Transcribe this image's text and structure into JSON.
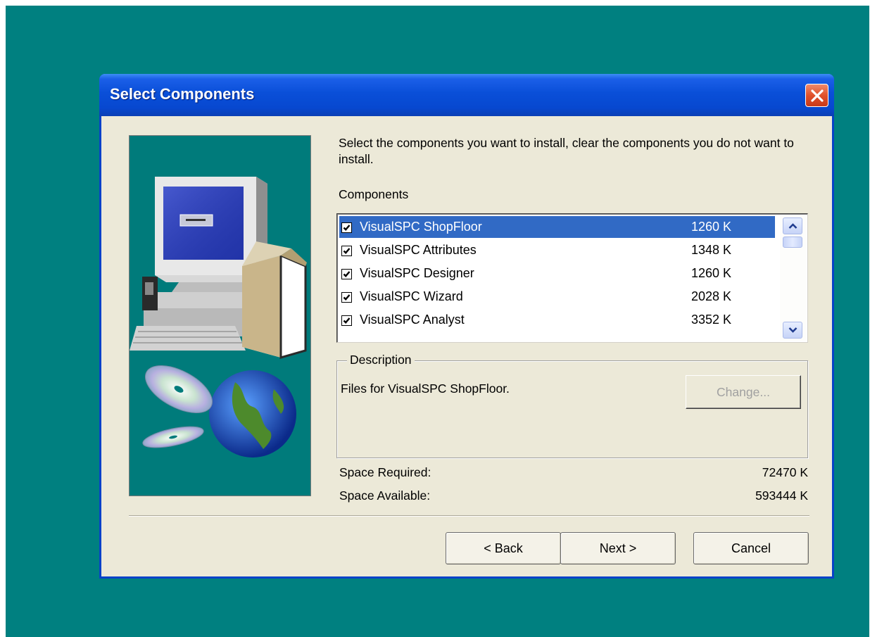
{
  "window": {
    "title": "Select Components"
  },
  "intro_text": "Select the components you want to install, clear the components you do not want to install.",
  "components": {
    "label": "Components",
    "items": [
      {
        "name": "VisualSPC ShopFloor",
        "size": "1260 K",
        "checked": true,
        "selected": true
      },
      {
        "name": "VisualSPC Attributes",
        "size": "1348 K",
        "checked": true,
        "selected": false
      },
      {
        "name": "VisualSPC Designer",
        "size": "1260 K",
        "checked": true,
        "selected": false
      },
      {
        "name": "VisualSPC Wizard",
        "size": "2028 K",
        "checked": true,
        "selected": false
      },
      {
        "name": "VisualSPC Analyst",
        "size": "3352 K",
        "checked": true,
        "selected": false
      }
    ]
  },
  "description": {
    "label": "Description",
    "text": "Files for VisualSPC ShopFloor.",
    "change_label": "Change..."
  },
  "space": {
    "required_label": "Space Required:",
    "required_value": "72470 K",
    "available_label": "Space Available:",
    "available_value": "593444 K"
  },
  "buttons": {
    "back": "< Back",
    "next": "Next >",
    "cancel": "Cancel"
  },
  "colors": {
    "desktop": "#008080",
    "titlebar": "#0a4fd8",
    "dialog": "#ece9d8",
    "selection": "#316ac5"
  },
  "icons": [
    "close-icon",
    "checkbox-check-icon",
    "scroll-up-icon",
    "scroll-down-icon",
    "installer-illustration"
  ]
}
